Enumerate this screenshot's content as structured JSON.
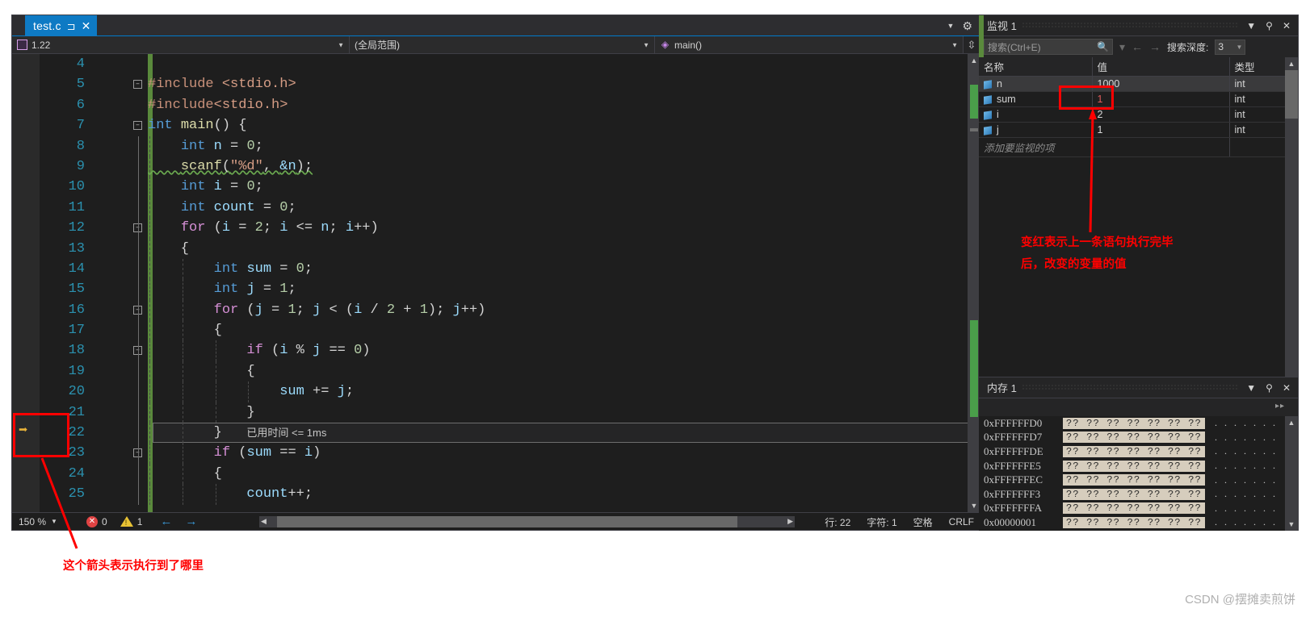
{
  "editor": {
    "tab": {
      "label": "test.c",
      "pin_icon": "pin-icon",
      "close_icon": "close-icon"
    },
    "nav": {
      "file_scope": "1.22",
      "member_scope": "(全局范围)",
      "function_scope": "main()"
    },
    "code_lines": [
      {
        "num": "4",
        "text": ""
      },
      {
        "num": "5",
        "fold": "minus",
        "tokens": [
          {
            "t": "#include ",
            "c": "pre"
          },
          {
            "t": "<stdio.h>",
            "c": "str"
          }
        ]
      },
      {
        "num": "6",
        "tokens": [
          {
            "t": "#include",
            "c": "pre"
          },
          {
            "t": "<stdio.h>",
            "c": "str"
          }
        ]
      },
      {
        "num": "7",
        "fold": "minus",
        "tokens": [
          {
            "t": "int",
            "c": "kw"
          },
          {
            "t": " ",
            "c": "pun"
          },
          {
            "t": "main",
            "c": "fn"
          },
          {
            "t": "() {",
            "c": "pun"
          }
        ]
      },
      {
        "num": "8",
        "tokens": [
          {
            "t": "    ",
            "c": "pun"
          },
          {
            "t": "int",
            "c": "kw"
          },
          {
            "t": " ",
            "c": "pun"
          },
          {
            "t": "n",
            "c": "var"
          },
          {
            "t": " = ",
            "c": "pun"
          },
          {
            "t": "0",
            "c": "num"
          },
          {
            "t": ";",
            "c": "pun"
          }
        ]
      },
      {
        "num": "9",
        "squiggle": true,
        "tokens": [
          {
            "t": "    ",
            "c": "pun"
          },
          {
            "t": "scanf",
            "c": "fn"
          },
          {
            "t": "(",
            "c": "pun"
          },
          {
            "t": "\"%d\"",
            "c": "str"
          },
          {
            "t": ", ",
            "c": "pun"
          },
          {
            "t": "&n",
            "c": "var"
          },
          {
            "t": ");",
            "c": "pun"
          }
        ]
      },
      {
        "num": "10",
        "tokens": [
          {
            "t": "    ",
            "c": "pun"
          },
          {
            "t": "int",
            "c": "kw"
          },
          {
            "t": " ",
            "c": "pun"
          },
          {
            "t": "i",
            "c": "var"
          },
          {
            "t": " = ",
            "c": "pun"
          },
          {
            "t": "0",
            "c": "num"
          },
          {
            "t": ";",
            "c": "pun"
          }
        ]
      },
      {
        "num": "11",
        "tokens": [
          {
            "t": "    ",
            "c": "pun"
          },
          {
            "t": "int",
            "c": "kw"
          },
          {
            "t": " ",
            "c": "pun"
          },
          {
            "t": "count",
            "c": "var"
          },
          {
            "t": " = ",
            "c": "pun"
          },
          {
            "t": "0",
            "c": "num"
          },
          {
            "t": ";",
            "c": "pun"
          }
        ]
      },
      {
        "num": "12",
        "fold": "minus",
        "tokens": [
          {
            "t": "    ",
            "c": "pun"
          },
          {
            "t": "for",
            "c": "kw2"
          },
          {
            "t": " (",
            "c": "pun"
          },
          {
            "t": "i",
            "c": "var"
          },
          {
            "t": " = ",
            "c": "pun"
          },
          {
            "t": "2",
            "c": "num"
          },
          {
            "t": "; ",
            "c": "pun"
          },
          {
            "t": "i",
            "c": "var"
          },
          {
            "t": " <= ",
            "c": "pun"
          },
          {
            "t": "n",
            "c": "var"
          },
          {
            "t": "; ",
            "c": "pun"
          },
          {
            "t": "i",
            "c": "var"
          },
          {
            "t": "++)",
            "c": "pun"
          }
        ]
      },
      {
        "num": "13",
        "tokens": [
          {
            "t": "    {",
            "c": "pun"
          }
        ]
      },
      {
        "num": "14",
        "tokens": [
          {
            "t": "        ",
            "c": "pun"
          },
          {
            "t": "int",
            "c": "kw"
          },
          {
            "t": " ",
            "c": "pun"
          },
          {
            "t": "sum",
            "c": "var"
          },
          {
            "t": " = ",
            "c": "pun"
          },
          {
            "t": "0",
            "c": "num"
          },
          {
            "t": ";",
            "c": "pun"
          }
        ]
      },
      {
        "num": "15",
        "tokens": [
          {
            "t": "        ",
            "c": "pun"
          },
          {
            "t": "int",
            "c": "kw"
          },
          {
            "t": " ",
            "c": "pun"
          },
          {
            "t": "j",
            "c": "var"
          },
          {
            "t": " = ",
            "c": "pun"
          },
          {
            "t": "1",
            "c": "num"
          },
          {
            "t": ";",
            "c": "pun"
          }
        ]
      },
      {
        "num": "16",
        "fold": "minus",
        "tokens": [
          {
            "t": "        ",
            "c": "pun"
          },
          {
            "t": "for",
            "c": "kw2"
          },
          {
            "t": " (",
            "c": "pun"
          },
          {
            "t": "j",
            "c": "var"
          },
          {
            "t": " = ",
            "c": "pun"
          },
          {
            "t": "1",
            "c": "num"
          },
          {
            "t": "; ",
            "c": "pun"
          },
          {
            "t": "j",
            "c": "var"
          },
          {
            "t": " < (",
            "c": "pun"
          },
          {
            "t": "i",
            "c": "var"
          },
          {
            "t": " / ",
            "c": "pun"
          },
          {
            "t": "2",
            "c": "num"
          },
          {
            "t": " + ",
            "c": "pun"
          },
          {
            "t": "1",
            "c": "num"
          },
          {
            "t": "); ",
            "c": "pun"
          },
          {
            "t": "j",
            "c": "var"
          },
          {
            "t": "++)",
            "c": "pun"
          }
        ]
      },
      {
        "num": "17",
        "tokens": [
          {
            "t": "        {",
            "c": "pun"
          }
        ]
      },
      {
        "num": "18",
        "fold": "minus",
        "tokens": [
          {
            "t": "            ",
            "c": "pun"
          },
          {
            "t": "if",
            "c": "kw2"
          },
          {
            "t": " (",
            "c": "pun"
          },
          {
            "t": "i",
            "c": "var"
          },
          {
            "t": " % ",
            "c": "pun"
          },
          {
            "t": "j",
            "c": "var"
          },
          {
            "t": " == ",
            "c": "pun"
          },
          {
            "t": "0",
            "c": "num"
          },
          {
            "t": ")",
            "c": "pun"
          }
        ]
      },
      {
        "num": "19",
        "tokens": [
          {
            "t": "            {",
            "c": "pun"
          }
        ]
      },
      {
        "num": "20",
        "tokens": [
          {
            "t": "                ",
            "c": "pun"
          },
          {
            "t": "sum",
            "c": "var"
          },
          {
            "t": " += ",
            "c": "pun"
          },
          {
            "t": "j",
            "c": "var"
          },
          {
            "t": ";",
            "c": "pun"
          }
        ]
      },
      {
        "num": "21",
        "tokens": [
          {
            "t": "            }",
            "c": "pun"
          }
        ]
      },
      {
        "num": "22",
        "current": true,
        "tokens": [
          {
            "t": "        }",
            "c": "pun"
          }
        ],
        "diagnostic": "已用时间 <= 1ms"
      },
      {
        "num": "23",
        "fold": "minus",
        "tokens": [
          {
            "t": "        ",
            "c": "pun"
          },
          {
            "t": "if",
            "c": "kw2"
          },
          {
            "t": " (",
            "c": "pun"
          },
          {
            "t": "sum",
            "c": "var"
          },
          {
            "t": " == ",
            "c": "pun"
          },
          {
            "t": "i",
            "c": "var"
          },
          {
            "t": ")",
            "c": "pun"
          }
        ]
      },
      {
        "num": "24",
        "tokens": [
          {
            "t": "        {",
            "c": "pun"
          }
        ]
      },
      {
        "num": "25",
        "tokens": [
          {
            "t": "            ",
            "c": "pun"
          },
          {
            "t": "count",
            "c": "var"
          },
          {
            "t": "++;",
            "c": "pun"
          }
        ]
      }
    ],
    "status": {
      "zoom": "150 %",
      "error_count": "0",
      "warning_count": "1",
      "line_label": "行: 22",
      "char_label": "字符: 1",
      "spaces_label": "空格",
      "eol_label": "CRLF"
    }
  },
  "watch_panel": {
    "title": "监视 1",
    "search_placeholder": "搜索(Ctrl+E)",
    "depth_label": "搜索深度:",
    "depth_value": "3",
    "columns": [
      "名称",
      "值",
      "类型"
    ],
    "rows": [
      {
        "name": "n",
        "value": "1000",
        "type": "int",
        "selected": true,
        "changed": false
      },
      {
        "name": "sum",
        "value": "1",
        "type": "int",
        "selected": false,
        "changed": true
      },
      {
        "name": "i",
        "value": "2",
        "type": "int",
        "selected": false,
        "changed": false
      },
      {
        "name": "j",
        "value": "1",
        "type": "int",
        "selected": false,
        "changed": false
      }
    ],
    "add_row_placeholder": "添加要监视的项"
  },
  "memory_panel": {
    "title": "内存 1",
    "rows": [
      {
        "addr": "0xFFFFFFD0",
        "bytes": "?? ?? ?? ?? ?? ?? ??",
        "ascii": ". . . . . . ."
      },
      {
        "addr": "0xFFFFFFD7",
        "bytes": "?? ?? ?? ?? ?? ?? ??",
        "ascii": ". . . . . . ."
      },
      {
        "addr": "0xFFFFFFDE",
        "bytes": "?? ?? ?? ?? ?? ?? ??",
        "ascii": ". . . . . . ."
      },
      {
        "addr": "0xFFFFFFE5",
        "bytes": "?? ?? ?? ?? ?? ?? ??",
        "ascii": ". . . . . . ."
      },
      {
        "addr": "0xFFFFFFEC",
        "bytes": "?? ?? ?? ?? ?? ?? ??",
        "ascii": ". . . . . . ."
      },
      {
        "addr": "0xFFFFFFF3",
        "bytes": "?? ?? ?? ?? ?? ?? ??",
        "ascii": ". . . . . . ."
      },
      {
        "addr": "0xFFFFFFFA",
        "bytes": "?? ?? ?? ?? ?? ?? ??",
        "ascii": ". . . . . . ."
      },
      {
        "addr": "0x00000001",
        "bytes": "?? ?? ?? ?? ?? ?? ??",
        "ascii": ". . . . . . ."
      }
    ]
  },
  "annotations": {
    "watch_note_line1": "变红表示上一条语句执行完毕",
    "watch_note_line2": "后，改变的变量的值",
    "arrow_note": "这个箭头表示执行到了哪里",
    "accent_color": "#ff0000"
  },
  "watermark": "CSDN @摆摊卖煎饼"
}
